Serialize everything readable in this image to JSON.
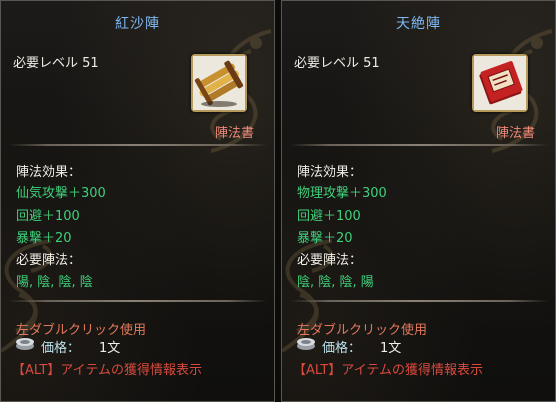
{
  "tooltips": [
    {
      "title": "紅沙陣",
      "required_level": "必要レベル 51",
      "item_type": "陣法書",
      "icon": "scroll-bundle-icon",
      "effect_header": "陣法効果：",
      "effects": [
        "仙気攻撃＋300",
        "回避＋100",
        "暴撃＋20"
      ],
      "required_header": "必要陣法：",
      "required_formation": "陽, 陰, 陰, 陰",
      "usage": "左ダブルクリック使用",
      "price_label": "価格：",
      "price_value": "1文",
      "alt_hint": "【ALT】アイテムの獲得情報表示"
    },
    {
      "title": "天絶陣",
      "required_level": "必要レベル 51",
      "item_type": "陣法書",
      "icon": "red-book-icon",
      "effect_header": "陣法効果：",
      "effects": [
        "物理攻撃＋300",
        "回避＋100",
        "暴撃＋20"
      ],
      "required_header": "必要陣法：",
      "required_formation": "陰, 陰, 陰, 陽",
      "usage": "左ダブルクリック使用",
      "price_label": "価格：",
      "price_value": "1文",
      "alt_hint": "【ALT】アイテムの獲得情報表示"
    }
  ],
  "colors": {
    "title": "#7fb8f2",
    "effect": "#3fd07a",
    "item_type": "#f08a7a",
    "usage": "#e2795c",
    "alt": "#d84a3e"
  }
}
